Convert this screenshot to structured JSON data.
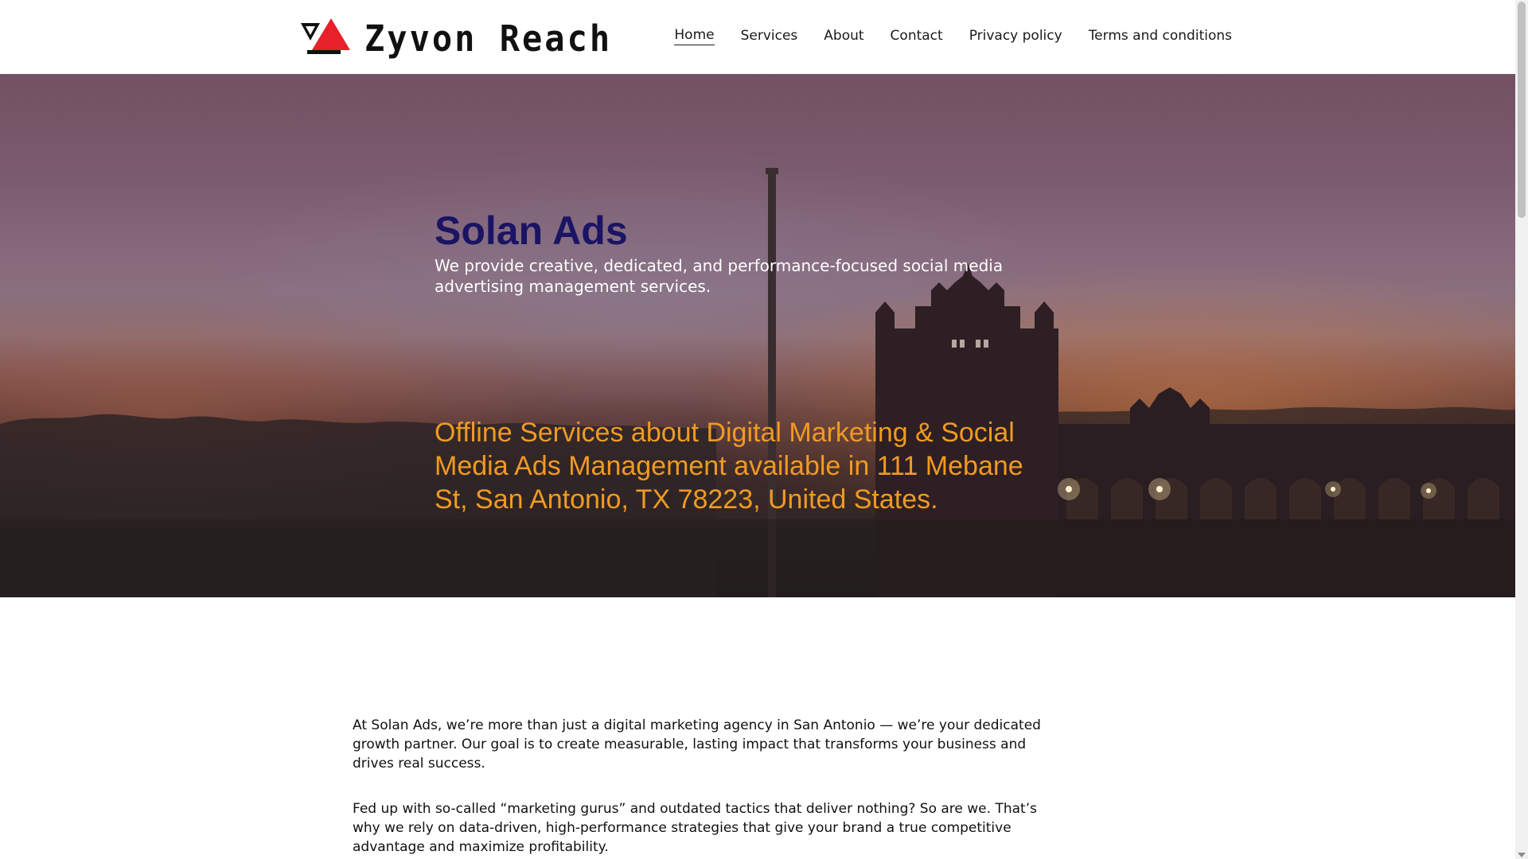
{
  "header": {
    "logo_text": "Zyvon Reach",
    "logo_icon": "triangle-logo-icon",
    "nav": [
      {
        "label": "Home",
        "active": true
      },
      {
        "label": "Services"
      },
      {
        "label": "About"
      },
      {
        "label": "Contact"
      },
      {
        "label": "Privacy policy"
      },
      {
        "label": "Terms and conditions"
      }
    ]
  },
  "hero": {
    "title": "Solan Ads",
    "subtitle": "We provide creative, dedicated, and performance-focused social media advertising management services.",
    "tagline": "Offline Services about Digital Marketing & Social Media Ads Management available in 111 Mebane St, San Antonio, TX 78223, United States.",
    "colors": {
      "title": "#1b1464",
      "tagline": "#f09a22",
      "subtitle": "#ffffff"
    }
  },
  "content": {
    "paragraphs": [
      "At Solan Ads, we’re more than just a digital marketing agency in San Antonio —  we’re your dedicated growth partner. Our goal is to create measurable, lasting impact that transforms your business and drives real success.",
      "Fed up with so-called “marketing gurus” and outdated tactics that deliver nothing? So are we. That’s why we rely on data-driven, high-performance strategies that give your brand a true competitive advantage and maximize profitability."
    ]
  },
  "colors": {
    "logo_red": "#e8202a",
    "logo_black": "#111111"
  }
}
